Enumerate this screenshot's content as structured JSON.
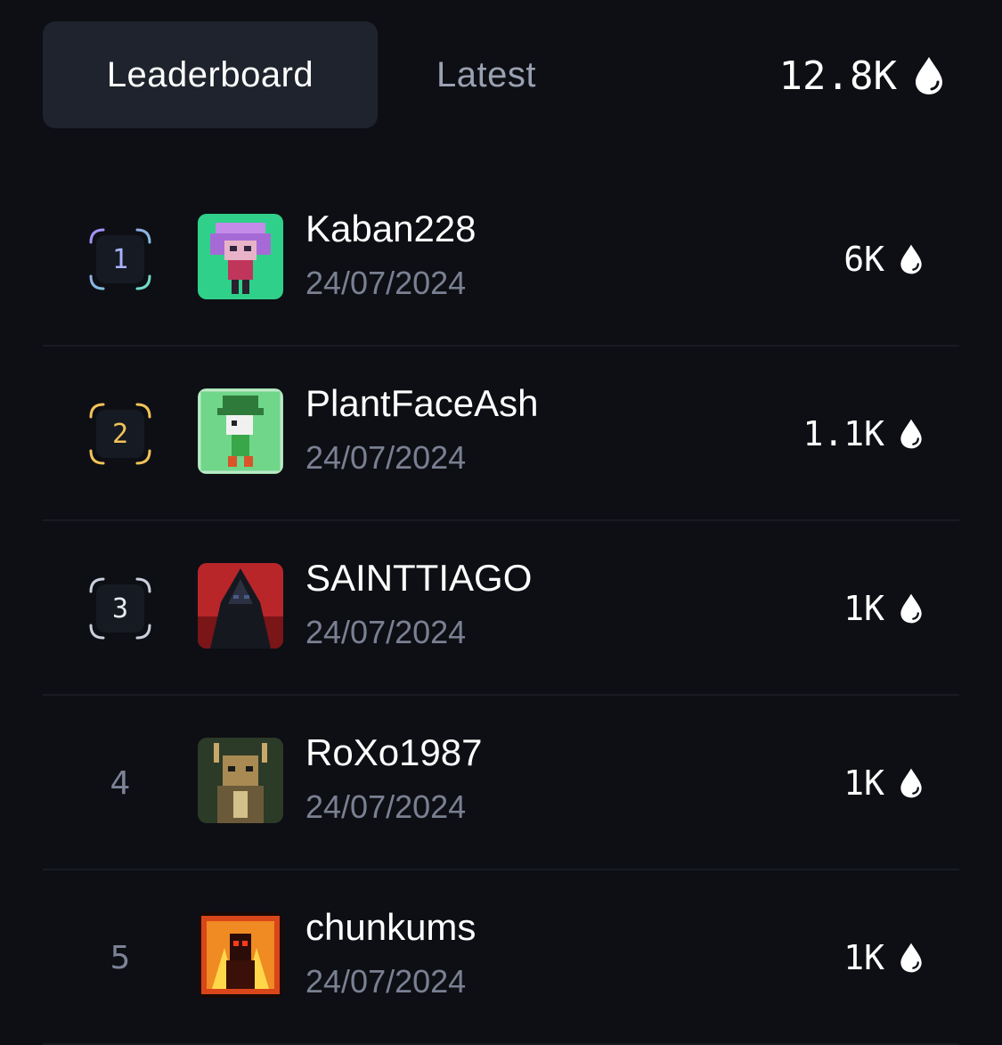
{
  "tabs": {
    "leaderboard": "Leaderboard",
    "latest": "Latest"
  },
  "total": "12.8K",
  "rows": [
    {
      "rank": "1",
      "name": "Kaban228",
      "date": "24/07/2024",
      "score": "6K"
    },
    {
      "rank": "2",
      "name": "PlantFaceAsh",
      "date": "24/07/2024",
      "score": "1.1K"
    },
    {
      "rank": "3",
      "name": "SAINTTIAGO",
      "date": "24/07/2024",
      "score": "1K"
    },
    {
      "rank": "4",
      "name": "RoXo1987",
      "date": "24/07/2024",
      "score": "1K"
    },
    {
      "rank": "5",
      "name": "chunkums",
      "date": "24/07/2024",
      "score": "1K"
    }
  ],
  "colors": {
    "background": "#0d0f14",
    "active_tab": "#1e232d",
    "rank1_from": "#a88bff",
    "rank1_to": "#6ee0c4",
    "rank2": "#f2c35a",
    "rank3": "#c9cfdb",
    "muted_text": "#7a8092"
  },
  "icons": {
    "points": "droplet-icon"
  }
}
